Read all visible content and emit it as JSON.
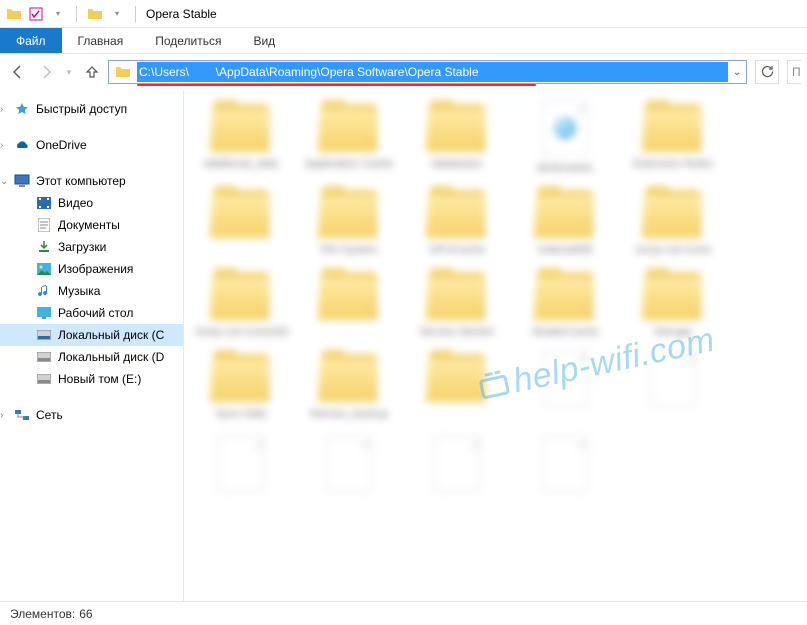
{
  "window": {
    "title": "Opera Stable"
  },
  "ribbon": {
    "file": "Файл",
    "home": "Главная",
    "share": "Поделиться",
    "view": "Вид"
  },
  "address": {
    "path": "C:\\Users\\        \\AppData\\Roaming\\Opera Software\\Opera Stable"
  },
  "search": {
    "prefix": "П"
  },
  "sidebar": {
    "quick_access": "Быстрый доступ",
    "onedrive": "OneDrive",
    "this_pc": "Этот компьютер",
    "videos": "Видео",
    "documents": "Документы",
    "downloads": "Загрузки",
    "pictures": "Изображения",
    "music": "Музыка",
    "desktop": "Рабочий стол",
    "local_c": "Локальный диск (C",
    "local_d": "Локальный диск (D",
    "new_vol_e": "Новый том (E:)",
    "network": "Сеть"
  },
  "status": {
    "items_label": "Элементов:",
    "items_count": "66"
  },
  "watermark": "help-wifi.com",
  "grid": {
    "items": [
      {
        "type": "folder",
        "label": "additional_data"
      },
      {
        "type": "folder",
        "label": "Application Cache"
      },
      {
        "type": "folder",
        "label": "databases"
      },
      {
        "type": "file-db",
        "label": "dictionaries"
      },
      {
        "type": "folder",
        "label": "Extension Rules"
      },
      {
        "type": "folder",
        "label": ""
      },
      {
        "type": "folder",
        "label": "File System"
      },
      {
        "type": "folder",
        "label": "GPUCache"
      },
      {
        "type": "folder",
        "label": "IndexedDB"
      },
      {
        "type": "folder",
        "label": "Jump List Icons"
      },
      {
        "type": "folder",
        "label": "Jump List IconsOld"
      },
      {
        "type": "folder",
        "label": ""
      },
      {
        "type": "folder",
        "label": "Service Worker"
      },
      {
        "type": "folder",
        "label": "ShaderCache"
      },
      {
        "type": "folder",
        "label": "Storage"
      },
      {
        "type": "folder",
        "label": "Sync Data"
      },
      {
        "type": "folder",
        "label": "themes_backup"
      },
      {
        "type": "folder",
        "label": ""
      },
      {
        "type": "file",
        "label": ""
      },
      {
        "type": "file",
        "label": ""
      },
      {
        "type": "file",
        "label": ""
      },
      {
        "type": "file",
        "label": ""
      },
      {
        "type": "file",
        "label": ""
      },
      {
        "type": "file",
        "label": ""
      }
    ]
  }
}
